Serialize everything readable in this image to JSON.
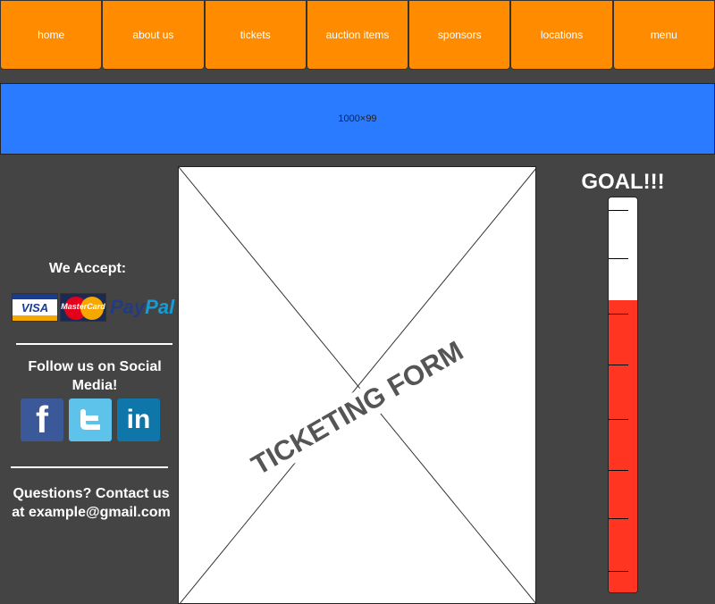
{
  "nav": {
    "items": [
      {
        "label": "home"
      },
      {
        "label": "about us"
      },
      {
        "label": "tickets"
      },
      {
        "label": "auction items"
      },
      {
        "label": "sponsors"
      },
      {
        "label": "locations"
      },
      {
        "label": "menu"
      }
    ]
  },
  "banner": {
    "placeholder_text": "1000×99"
  },
  "sidebar": {
    "accept_heading": "We Accept:",
    "payment": {
      "visa": "VISA",
      "mastercard": "MasterCard",
      "paypal_1": "Pay",
      "paypal_2": "Pal"
    },
    "follow_heading": "Follow us on Social Media!",
    "social": {
      "facebook": "f",
      "linkedin": "in"
    },
    "contact_text": "Questions? Contact us at example@gmail.com"
  },
  "main": {
    "form_label": "TICKETING FORM"
  },
  "goal": {
    "title": "GOAL!!!",
    "progress_percent": 74
  },
  "colors": {
    "nav_bg": "#ff8c00",
    "banner_bg": "#2a7bff",
    "page_bg": "#444444",
    "goal_fill": "#ff3522"
  }
}
